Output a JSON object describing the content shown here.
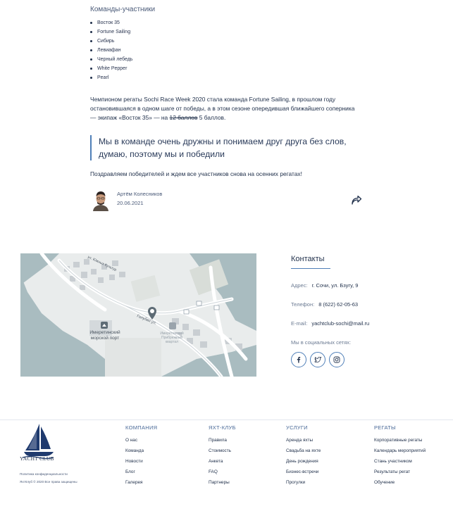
{
  "teams": {
    "title": "Команды-участники",
    "items": [
      "Восток 35",
      "Fortune Sailing",
      "Сибирь",
      "Левиафан",
      "Черный лебедь",
      "White Pepper",
      "Pearl"
    ]
  },
  "article": {
    "para_before": "Чемпионом регаты Sochi Race Week 2020 стала команда Fortune Sailing, в прошлом году остановившаяся в одном шаге от победы, а в этом сезоне опередившая ближайшего соперника — экипаж «Восток 35» — на ",
    "para_struck": "12 баллов",
    "para_after": " 5 баллов.",
    "quote": "Мы в команде очень дружны и понимаем друг друга без слов, думаю, поэтому мы и победили",
    "congrats": "Поздравляем победителей и ждем все участников снова на осенних регатах!",
    "author_name": "Артём Колесников",
    "author_date": "20.06.2021"
  },
  "map": {
    "label_port": "Имеретинский морской порт",
    "label_port_l1": "Имеретинский",
    "label_port_l2": "морской порт",
    "label_harbor_l1": "Имеретинский",
    "label_harbor_l2": "Прибрежный",
    "label_harbor_l3": "квартал",
    "label_street1": "Голубая ул.",
    "label_street2": "ул. Южных Культур"
  },
  "contacts": {
    "title": "Контакты",
    "address_label": "Адрес:",
    "address": "г. Сочи, ул. Бзугу, 9",
    "phone_label": "Телефон:",
    "phone": "8 (622) 62-05-63",
    "email_label": "E-mail:",
    "email": "yachtclub-sochi@mail.ru",
    "social_label": "Мы в социальных сетях:"
  },
  "footer": {
    "logo_text": "YACHT CLUB",
    "policy": "Политика конфиденциальности",
    "copyright": "ЯхтКлуб © 2020 Все права защищены",
    "columns": [
      {
        "head": "КОМПАНИЯ",
        "items": [
          "О нас",
          "Команда",
          "Новости",
          "Блог",
          "Галерея"
        ]
      },
      {
        "head": "ЯХТ-КЛУБ",
        "items": [
          "Правила",
          "Стоимость",
          "Анкета",
          "FAQ",
          "Партнеры"
        ]
      },
      {
        "head": "УСЛУГИ",
        "items": [
          "Аренда яхты",
          "Свадьба на яхте",
          "День рождения",
          "Бизнес-встречи",
          "Прогулки"
        ]
      },
      {
        "head": "РЕГАТЫ",
        "items": [
          "Корпоративные регаты",
          "Календарь мероприятий",
          "Стань участником",
          "Результаты регат",
          "Обучение"
        ]
      }
    ]
  },
  "colors": {
    "accent": "#4f7fb8",
    "text": "#1f2f4a",
    "map_water": "#a9bcc0",
    "map_land": "#e9ecec"
  }
}
